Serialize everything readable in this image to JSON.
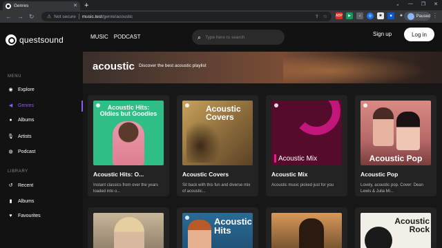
{
  "browser": {
    "tab_title": "Genres",
    "new_tab": "+",
    "not_secure": "Not secure",
    "url_host": "music.test",
    "url_path": "/genre/acoustic",
    "profile_status": "Paused",
    "ext_abp": "ABP"
  },
  "app": {
    "logo": "questsound",
    "topnav": [
      "MUSIC",
      "PODCAST"
    ],
    "search_placeholder": "Type here to search",
    "signup": "Sign up",
    "login": "Log in"
  },
  "sidebar": {
    "menu_heading": "MENU",
    "menu": [
      {
        "label": "Explore",
        "icon": "compass-icon"
      },
      {
        "label": "Genres",
        "icon": "megaphone-icon",
        "active": true
      },
      {
        "label": "Albums",
        "icon": "album-icon"
      },
      {
        "label": "Artists",
        "icon": "mic-icon"
      },
      {
        "label": "Podcast",
        "icon": "podcast-icon"
      }
    ],
    "library_heading": "LIBRARY",
    "library": [
      {
        "label": "Recent",
        "icon": "history-icon"
      },
      {
        "label": "Albums",
        "icon": "bookmark-icon"
      },
      {
        "label": "Favourites",
        "icon": "heart-icon"
      }
    ]
  },
  "genre": {
    "name": "acoustic",
    "description": "Discover the best acoustic playlist"
  },
  "playlists": [
    {
      "name": "Acoustic Hits: O...",
      "description": "Instant classics from over the years loaded into o...",
      "cover_text": "Acoustic Hits:\nOldies but Goodies"
    },
    {
      "name": "Acoustic Covers",
      "description": "Sit back with this fun and diverse mix of acoustic...",
      "cover_text": "Acoustic\nCovers"
    },
    {
      "name": "Acoustic Mix",
      "description": "Acoustic music picked just for you",
      "cover_text": "Acoustic Mix"
    },
    {
      "name": "Acoustic Pop",
      "description": "Lovely, acoustic pop. Cover: Dean Lewis & Julia Mi...",
      "cover_text": "Acoustic Pop"
    }
  ],
  "second_row": [
    {
      "cover_text": ""
    },
    {
      "cover_text": "Acoustic\nHits"
    },
    {
      "cover_text": ""
    },
    {
      "cover_text": "Acoustic\nRock"
    }
  ],
  "colors": {
    "accent": "#8b5cf6",
    "background": "#121212"
  }
}
